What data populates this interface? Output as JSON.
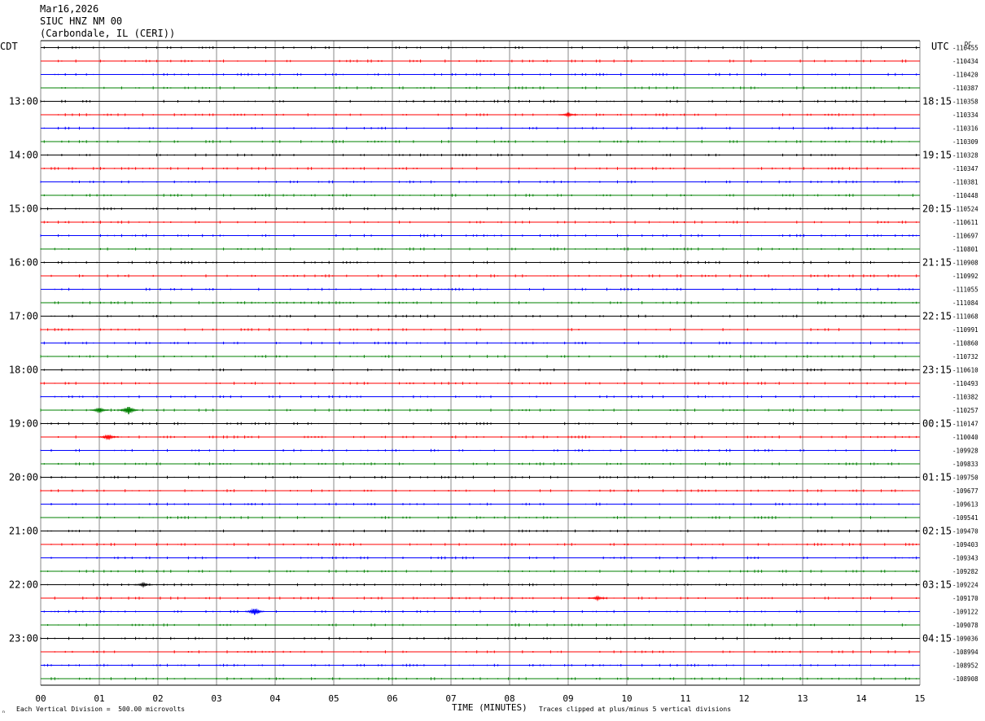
{
  "header": {
    "date": "Mar16,2026",
    "station": "SIUC HNZ NM 00",
    "location": "(Carbondale, IL (CERI))"
  },
  "left_timezone": "CDT",
  "right_timezone": "UTC",
  "dc_label": "DC",
  "footer": {
    "scale_note": "Each Vertical Division =  500.00 microvolts",
    "xlabel": "TIME (MINUTES)",
    "clip_note": "Traces clipped at plus/minus 5 vertical divisions",
    "corner_mark": "ₙ"
  },
  "colors": {
    "trace_cycle": [
      "#000000",
      "#ff0000",
      "#0000ff",
      "#008000"
    ],
    "grid": "#888888"
  },
  "chart_data": {
    "type": "helicorder",
    "xlabel": "TIME (MINUTES)",
    "x_ticks": [
      "00",
      "01",
      "02",
      "03",
      "04",
      "05",
      "06",
      "07",
      "08",
      "09",
      "10",
      "11",
      "12",
      "13",
      "14",
      "15"
    ],
    "x_range": [
      0,
      15
    ],
    "minutes_per_line": 15,
    "line_count": 48,
    "left_time_labels": [
      {
        "line": 4,
        "label": "13:00"
      },
      {
        "line": 8,
        "label": "14:00"
      },
      {
        "line": 12,
        "label": "15:00"
      },
      {
        "line": 16,
        "label": "16:00"
      },
      {
        "line": 20,
        "label": "17:00"
      },
      {
        "line": 24,
        "label": "18:00"
      },
      {
        "line": 28,
        "label": "19:00"
      },
      {
        "line": 32,
        "label": "20:00"
      },
      {
        "line": 36,
        "label": "21:00"
      },
      {
        "line": 40,
        "label": "22:00"
      },
      {
        "line": 44,
        "label": "23:00"
      }
    ],
    "right_time_labels": [
      {
        "line": 4,
        "label": "18:15"
      },
      {
        "line": 8,
        "label": "19:15"
      },
      {
        "line": 12,
        "label": "20:15"
      },
      {
        "line": 16,
        "label": "21:15"
      },
      {
        "line": 20,
        "label": "22:15"
      },
      {
        "line": 24,
        "label": "23:15"
      },
      {
        "line": 28,
        "label": "00:15"
      },
      {
        "line": 32,
        "label": "01:15"
      },
      {
        "line": 36,
        "label": "02:15"
      },
      {
        "line": 40,
        "label": "03:15"
      },
      {
        "line": 44,
        "label": "04:15"
      }
    ],
    "dc_offsets": [
      "-110455",
      "-110434",
      "-110420",
      "-110387",
      "-110358",
      "-110334",
      "-110316",
      "-110309",
      "-110328",
      "-110347",
      "-110381",
      "-110448",
      "-110524",
      "-110611",
      "-110697",
      "-110801",
      "-110908",
      "-110992",
      "-111055",
      "-111084",
      "-111068",
      "-110991",
      "-110860",
      "-110732",
      "-110610",
      "-110493",
      "-110382",
      "-110257",
      "-110147",
      "-110040",
      "-109928",
      "-109833",
      "-109750",
      "-109677",
      "-109613",
      "-109541",
      "-109470",
      "-109403",
      "-109343",
      "-109282",
      "-109224",
      "-109170",
      "-109122",
      "-109078",
      "-109036",
      "-108994",
      "-108952",
      "-108908"
    ],
    "events": [
      {
        "line": 27,
        "minute": 1.0,
        "amplitude": 3
      },
      {
        "line": 27,
        "minute": 1.5,
        "amplitude": 5
      },
      {
        "line": 29,
        "minute": 1.15,
        "amplitude": 3
      },
      {
        "line": 42,
        "minute": 3.65,
        "amplitude": 4
      },
      {
        "line": 40,
        "minute": 1.75,
        "amplitude": 2
      },
      {
        "line": 41,
        "minute": 9.5,
        "amplitude": 2
      },
      {
        "line": 5,
        "minute": 9.0,
        "amplitude": 2
      }
    ],
    "scale": "500.00 microvolts per vertical division"
  }
}
